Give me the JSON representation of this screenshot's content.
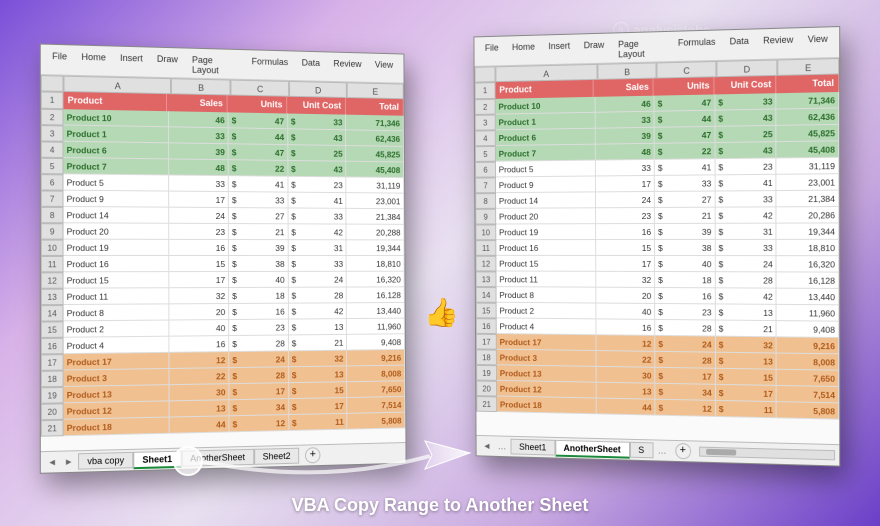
{
  "watermark_text": "analysistabs",
  "ribbon_tabs": [
    "File",
    "Home",
    "Insert",
    "Draw",
    "Page Layout",
    "Formulas",
    "Data",
    "Review",
    "View"
  ],
  "columns": [
    "A",
    "B",
    "C",
    "D",
    "E"
  ],
  "headers": {
    "product": "Product",
    "sales": "Sales",
    "units": "Units",
    "unitcost": "Unit Cost",
    "total": "Total"
  },
  "left": {
    "rows": [
      {
        "style": "green",
        "n": "Product 10",
        "s": "46",
        "u": "47",
        "uc": "33",
        "t": "71,346"
      },
      {
        "style": "green",
        "n": "Product 1",
        "s": "33",
        "u": "44",
        "uc": "43",
        "t": "62,436"
      },
      {
        "style": "green",
        "n": "Product 6",
        "s": "39",
        "u": "47",
        "uc": "25",
        "t": "45,825"
      },
      {
        "style": "green",
        "n": "Product 7",
        "s": "48",
        "u": "22",
        "uc": "43",
        "t": "45,408"
      },
      {
        "style": "plain",
        "n": "Product 5",
        "s": "33",
        "u": "41",
        "uc": "23",
        "t": "31,119"
      },
      {
        "style": "plain",
        "n": "Product 9",
        "s": "17",
        "u": "33",
        "uc": "41",
        "t": "23,001"
      },
      {
        "style": "plain",
        "n": "Product 14",
        "s": "24",
        "u": "27",
        "uc": "33",
        "t": "21,384"
      },
      {
        "style": "plain",
        "n": "Product 20",
        "s": "23",
        "u": "21",
        "uc": "42",
        "t": "20,288"
      },
      {
        "style": "plain",
        "n": "Product 19",
        "s": "16",
        "u": "39",
        "uc": "31",
        "t": "19,344"
      },
      {
        "style": "plain",
        "n": "Product 16",
        "s": "15",
        "u": "38",
        "uc": "33",
        "t": "18,810"
      },
      {
        "style": "plain",
        "n": "Product 15",
        "s": "17",
        "u": "40",
        "uc": "24",
        "t": "16,320"
      },
      {
        "style": "plain",
        "n": "Product 11",
        "s": "32",
        "u": "18",
        "uc": "28",
        "t": "16,128"
      },
      {
        "style": "plain",
        "n": "Product 8",
        "s": "20",
        "u": "16",
        "uc": "42",
        "t": "13,440"
      },
      {
        "style": "plain",
        "n": "Product 2",
        "s": "40",
        "u": "23",
        "uc": "13",
        "t": "11,960"
      },
      {
        "style": "plain",
        "n": "Product 4",
        "s": "16",
        "u": "28",
        "uc": "21",
        "t": "9,408"
      },
      {
        "style": "orange",
        "n": "Product 17",
        "s": "12",
        "u": "24",
        "uc": "32",
        "t": "9,216"
      },
      {
        "style": "orange",
        "n": "Product 3",
        "s": "22",
        "u": "28",
        "uc": "13",
        "t": "8,008"
      },
      {
        "style": "orange",
        "n": "Product 13",
        "s": "30",
        "u": "17",
        "uc": "15",
        "t": "7,650"
      },
      {
        "style": "orange",
        "n": "Product 12",
        "s": "13",
        "u": "34",
        "uc": "17",
        "t": "7,514"
      },
      {
        "style": "orange",
        "n": "Product 18",
        "s": "44",
        "u": "12",
        "uc": "11",
        "t": "5,808"
      }
    ],
    "sheets": [
      "vba copy",
      "Sheet1",
      "AnotherSheet",
      "Sheet2"
    ],
    "active_sheet": "Sheet1"
  },
  "right": {
    "rows": [
      {
        "style": "green",
        "n": "Product 10",
        "s": "46",
        "u": "47",
        "uc": "33",
        "t": "71,346"
      },
      {
        "style": "green",
        "n": "Product 1",
        "s": "33",
        "u": "44",
        "uc": "43",
        "t": "62,436"
      },
      {
        "style": "green",
        "n": "Product 6",
        "s": "39",
        "u": "47",
        "uc": "25",
        "t": "45,825"
      },
      {
        "style": "green",
        "n": "Product 7",
        "s": "48",
        "u": "22",
        "uc": "43",
        "t": "45,408"
      },
      {
        "style": "plain",
        "n": "Product 5",
        "s": "33",
        "u": "41",
        "uc": "23",
        "t": "31,119"
      },
      {
        "style": "plain",
        "n": "Product 9",
        "s": "17",
        "u": "33",
        "uc": "41",
        "t": "23,001"
      },
      {
        "style": "plain",
        "n": "Product 14",
        "s": "24",
        "u": "27",
        "uc": "33",
        "t": "21,384"
      },
      {
        "style": "plain",
        "n": "Product 20",
        "s": "23",
        "u": "21",
        "uc": "42",
        "t": "20,286"
      },
      {
        "style": "plain",
        "n": "Product 19",
        "s": "16",
        "u": "39",
        "uc": "31",
        "t": "19,344"
      },
      {
        "style": "plain",
        "n": "Product 16",
        "s": "15",
        "u": "38",
        "uc": "33",
        "t": "18,810"
      },
      {
        "style": "plain",
        "n": "Product 15",
        "s": "17",
        "u": "40",
        "uc": "24",
        "t": "16,320"
      },
      {
        "style": "plain",
        "n": "Product 11",
        "s": "32",
        "u": "18",
        "uc": "28",
        "t": "16,128"
      },
      {
        "style": "plain",
        "n": "Product 8",
        "s": "20",
        "u": "16",
        "uc": "42",
        "t": "13,440"
      },
      {
        "style": "plain",
        "n": "Product 2",
        "s": "40",
        "u": "23",
        "uc": "13",
        "t": "11,960"
      },
      {
        "style": "plain",
        "n": "Product 4",
        "s": "16",
        "u": "28",
        "uc": "21",
        "t": "9,408"
      },
      {
        "style": "orange",
        "n": "Product 17",
        "s": "12",
        "u": "24",
        "uc": "32",
        "t": "9,216"
      },
      {
        "style": "orange",
        "n": "Product 3",
        "s": "22",
        "u": "28",
        "uc": "13",
        "t": "8,008"
      },
      {
        "style": "orange",
        "n": "Product 13",
        "s": "30",
        "u": "17",
        "uc": "15",
        "t": "7,650"
      },
      {
        "style": "orange",
        "n": "Product 12",
        "s": "13",
        "u": "34",
        "uc": "17",
        "t": "7,514"
      },
      {
        "style": "orange",
        "n": "Product 18",
        "s": "44",
        "u": "12",
        "uc": "11",
        "t": "5,808"
      }
    ],
    "sheets": [
      "Sheet1",
      "AnotherSheet",
      "S"
    ],
    "active_sheet": "AnotherSheet"
  },
  "caption": "VBA Copy Range to Another Sheet"
}
